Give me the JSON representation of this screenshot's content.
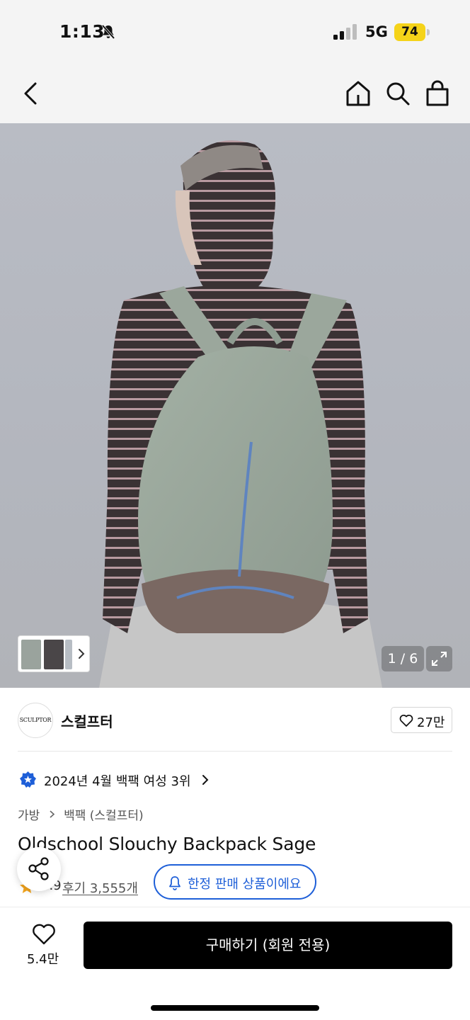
{
  "status_bar": {
    "time": "1:13",
    "network": "5G",
    "battery": "74"
  },
  "header": {
    "icons": [
      "back-arrow-icon",
      "home-icon",
      "search-icon",
      "shopping-bag-icon"
    ]
  },
  "gallery": {
    "page_indicator": "1 / 6",
    "expand_icon": "expand-icon",
    "thumbnail_count": 3
  },
  "brand": {
    "logo_text": "SCULPTOR",
    "name": "스컬프터",
    "likes": "27만"
  },
  "ranking": {
    "text": "2024년 4월 백팩 여성 3위"
  },
  "breadcrumb": [
    "가방",
    "백팩 (스컬프터)"
  ],
  "product": {
    "title": "Oldschool Slouchy Backpack Sage",
    "rating": "4.9",
    "reviews": "후기 3,555개",
    "limited_label": "한정 판매 상품이에요"
  },
  "bottom_bar": {
    "wish_count": "5.4만",
    "buy_label": "구매하기 (회원 전용)"
  },
  "colors": {
    "accent_blue": "#1e5fd8",
    "battery_yellow": "#f5d319",
    "star_orange": "#f4a51c",
    "primary_black": "#000000"
  }
}
